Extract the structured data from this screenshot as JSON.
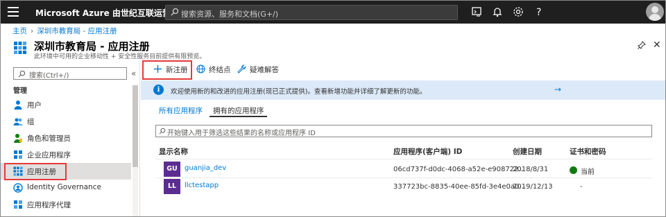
{
  "topbar": {
    "brand": "Microsoft Azure 由世纪互联运营",
    "search_placeholder": "搜索资源、服务和文档(G+/)",
    "icons": [
      "hamburger-icon",
      "cloud-shell-icon",
      "bell-icon",
      "gear-icon",
      "help-icon",
      "avatar"
    ]
  },
  "breadcrumb": {
    "home": "主页",
    "current": "深圳市教育局 - 应用注册"
  },
  "header": {
    "title": "深圳市教育局 - 应用注册",
    "subtitle": "此环境中可用的企业移动性 + 安全性服务目前提供有限预览。"
  },
  "sidebar": {
    "search_placeholder": "搜索(Ctrl+/)",
    "collapse": "«",
    "section_label": "管理",
    "items": [
      {
        "label": "用户",
        "icon": "user-icon"
      },
      {
        "label": "组",
        "icon": "group-icon"
      },
      {
        "label": "角色和管理员",
        "icon": "roles-icon"
      },
      {
        "label": "企业应用程序",
        "icon": "enterprise-apps-icon"
      },
      {
        "label": "应用注册",
        "icon": "app-registrations-icon",
        "active": true
      },
      {
        "label": "Identity Governance",
        "icon": "identity-governance-icon"
      },
      {
        "label": "应用程序代理",
        "icon": "app-proxy-icon"
      }
    ]
  },
  "toolbar": {
    "new_registration": "新注册",
    "endpoints": "终结点",
    "troubleshooting": "疑难解答"
  },
  "info_bar": {
    "text": "欢迎使用新的和改进的应用注册(现已正式提供)。查看新增功能并详细了解更新的功能。",
    "arrow": "→"
  },
  "tabs": {
    "all_apps": "所有应用程序",
    "owned_apps": "拥有的应用程序"
  },
  "filter": {
    "placeholder": "开始键入用于筛选这些结果的名称或应用程序 ID"
  },
  "table": {
    "headers": [
      "显示名称",
      "应用程序(客户端) ID",
      "创建日期",
      "证书和密码"
    ],
    "rows": [
      {
        "badge": "GU",
        "badge_color": "#5c2d91",
        "name": "guanjia_dev",
        "client_id": "06cd737f-d0dc-4068-a52e-e908722...",
        "created": "2018/8/31",
        "cert": "当前",
        "cert_status": "ok"
      },
      {
        "badge": "LL",
        "badge_color": "#5c2d91",
        "name": "llctestapp",
        "client_id": "337723bc-8835-40ee-85fd-3e4e0a0...",
        "created": "2019/12/13",
        "cert": "-",
        "cert_status": "none"
      }
    ]
  },
  "colors": {
    "topbar": "#1f1f1f",
    "accent": "#0078d4",
    "highlight": "#e5393a",
    "info_bg": "#dce9f8"
  }
}
